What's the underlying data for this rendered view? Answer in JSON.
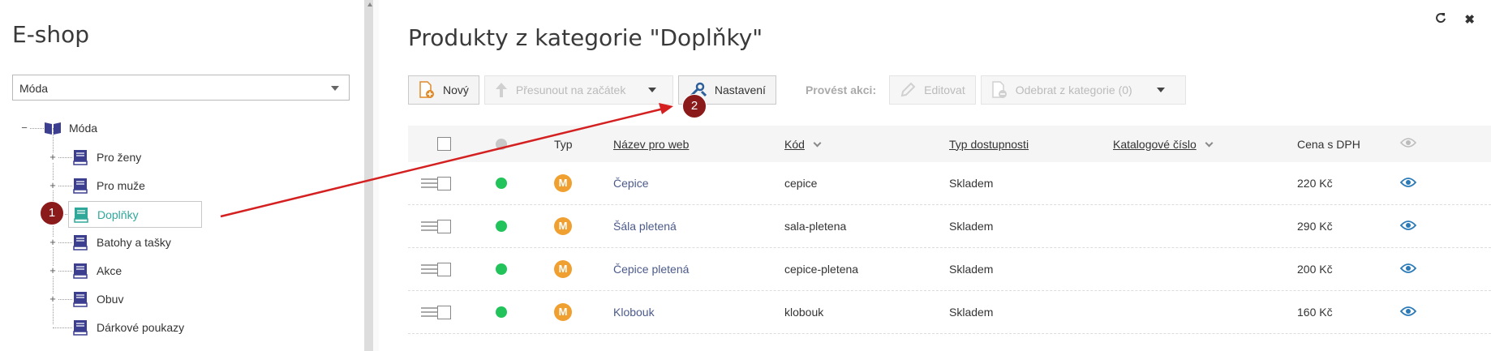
{
  "left": {
    "title": "E-shop",
    "category_select": {
      "value": "Móda"
    },
    "tree": {
      "root": {
        "label": "Móda"
      },
      "children": [
        {
          "label": "Pro ženy"
        },
        {
          "label": "Pro muže"
        },
        {
          "label": "Doplňky"
        },
        {
          "label": "Batohy a tašky"
        },
        {
          "label": "Akce"
        },
        {
          "label": "Obuv"
        },
        {
          "label": "Dárkové poukazy"
        }
      ]
    }
  },
  "main": {
    "title": "Produkty z kategorie \"Doplňky\"",
    "toolbar": {
      "new_label": "Nový",
      "move_label": "Přesunout na začátek",
      "settings_label": "Nastavení",
      "action_label": "Provést akci:",
      "edit_label": "Editovat",
      "remove_label": "Odebrat z kategorie (0)"
    },
    "table": {
      "columns": {
        "type": "Typ",
        "name": "Název pro web",
        "code": "Kód",
        "availability": "Typ dostupnosti",
        "catalog": "Katalogové číslo",
        "price": "Cena s DPH"
      },
      "rows": [
        {
          "type_badge": "M",
          "name": "Čepice",
          "code": "cepice",
          "availability": "Skladem",
          "price": "220 Kč"
        },
        {
          "type_badge": "M",
          "name": "Šála pletená",
          "code": "sala-pletena",
          "availability": "Skladem",
          "price": "290 Kč"
        },
        {
          "type_badge": "M",
          "name": "Čepice pletená",
          "code": "cepice-pletena",
          "availability": "Skladem",
          "price": "200 Kč"
        },
        {
          "type_badge": "M",
          "name": "Klobouk",
          "code": "klobouk",
          "availability": "Skladem",
          "price": "160 Kč"
        }
      ]
    }
  },
  "markers": [
    "1",
    "2"
  ],
  "colors": {
    "accent_teal": "#2fa89a",
    "status_green": "#22c35a",
    "badge_orange": "#f0a030",
    "marker_red": "#8b1a1a",
    "arrow_red": "#d42020"
  }
}
